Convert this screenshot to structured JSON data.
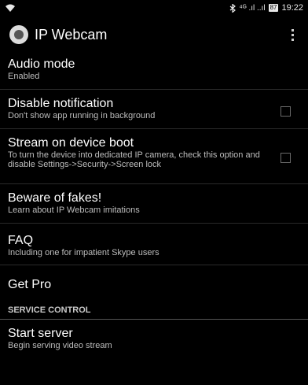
{
  "status_bar": {
    "signal_text": "⁴ᴳ .ıl ..ıl",
    "battery": "87",
    "time": "19:22"
  },
  "app_bar": {
    "title": "IP Webcam"
  },
  "settings": [
    {
      "title": "Audio mode",
      "summary": "Enabled",
      "checkbox": false
    },
    {
      "title": "Disable notification",
      "summary": "Don't show app running in background",
      "checkbox": true
    },
    {
      "title": "Stream on device boot",
      "summary": "To turn the device into dedicated IP camera, check this option and disable Settings->Security->Screen lock",
      "checkbox": true
    },
    {
      "title": "Beware of fakes!",
      "summary": "Learn about IP Webcam imitations",
      "checkbox": false
    },
    {
      "title": "FAQ",
      "summary": "Including one for impatient Skype users",
      "checkbox": false
    },
    {
      "title": "Get Pro",
      "summary": "",
      "checkbox": false
    }
  ],
  "section_header": "SERVICE CONTROL",
  "start_server": {
    "title": "Start server",
    "summary": "Begin serving video stream"
  },
  "colors": {
    "background": "#000000",
    "text": "#ffffff",
    "summary": "#bdbdbd",
    "divider": "#2a2a2a"
  }
}
